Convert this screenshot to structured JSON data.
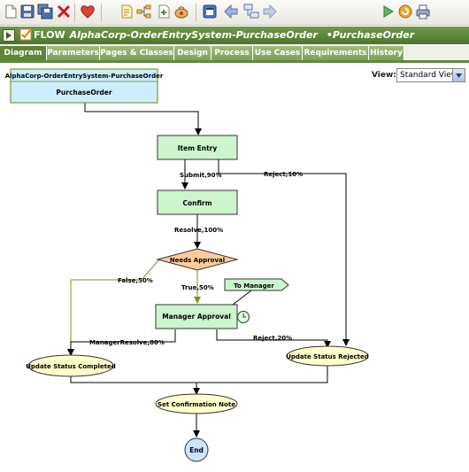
{
  "toolbar": {
    "buttons": [
      {
        "name": "new-document",
        "icon": "new-document-icon"
      },
      {
        "name": "save",
        "icon": "save-icon"
      },
      {
        "name": "save-all",
        "icon": "save-all-icon"
      },
      {
        "name": "delete",
        "icon": "delete-x-icon"
      },
      {
        "name": "favorite",
        "icon": "heart-icon"
      },
      {
        "name": "properties",
        "icon": "document-properties-icon"
      },
      {
        "name": "hierarchy",
        "icon": "hierarchy-icon"
      },
      {
        "name": "add-page",
        "icon": "add-page-icon"
      },
      {
        "name": "tools",
        "icon": "pot-icon"
      },
      {
        "name": "restore",
        "icon": "restore-window-icon"
      },
      {
        "name": "back",
        "icon": "back-arrow-icon"
      },
      {
        "name": "layout",
        "icon": "layout-icon"
      },
      {
        "name": "forward",
        "icon": "forward-arrow-icon"
      },
      {
        "name": "run",
        "icon": "play-icon"
      },
      {
        "name": "refresh",
        "icon": "refresh-icon"
      },
      {
        "name": "print",
        "icon": "printer-icon"
      }
    ]
  },
  "header": {
    "keyword": "FLOW",
    "flow_name": "AlphaCorp-OrderEntrySystem-PurchaseOrder",
    "class_name": "•PurchaseOrder"
  },
  "tabs": [
    {
      "label": "Diagram",
      "active": true
    },
    {
      "label": "Parameters",
      "active": false
    },
    {
      "label": "Pages & Classes",
      "active": false
    },
    {
      "label": "Design",
      "active": false
    },
    {
      "label": "Process",
      "active": false
    },
    {
      "label": "Use Cases",
      "active": false
    },
    {
      "label": "Requirements",
      "active": false
    },
    {
      "label": "History",
      "active": false
    }
  ],
  "view": {
    "label": "View:",
    "selected": "Standard View"
  },
  "diagram": {
    "start_box": {
      "title": "AlphaCorp-OrderEntrySystem-PurchaseOrder",
      "subtitle": "PurchaseOrder"
    },
    "nodes": {
      "item_entry": "Item Entry",
      "confirm": "Confirm",
      "needs_approval": "Needs Approval",
      "manager_approval": "Manager Approval",
      "to_manager": "To Manager",
      "update_completed": "Update Status Completed",
      "update_rejected": "Update Status Rejected",
      "set_confirmation": "Set Confirmation Note",
      "end": "End"
    },
    "connectors": {
      "submit": "Submit,90%",
      "reject_10": "Reject,10%",
      "resolve": "Resolve,100%",
      "false_50": "False,50%",
      "true_50": "True,50%",
      "manager_resolve": "ManagerResolve,80%",
      "reject_20": "Reject,20%"
    }
  },
  "colors": {
    "title_bar": "#5a8636",
    "assignment_fill": "#ccf5cc",
    "decision_fill": "#ffcc99",
    "utility_fill": "#ffffcc",
    "start_fill": "#cceeff",
    "end_fill": "#cce4ff"
  }
}
